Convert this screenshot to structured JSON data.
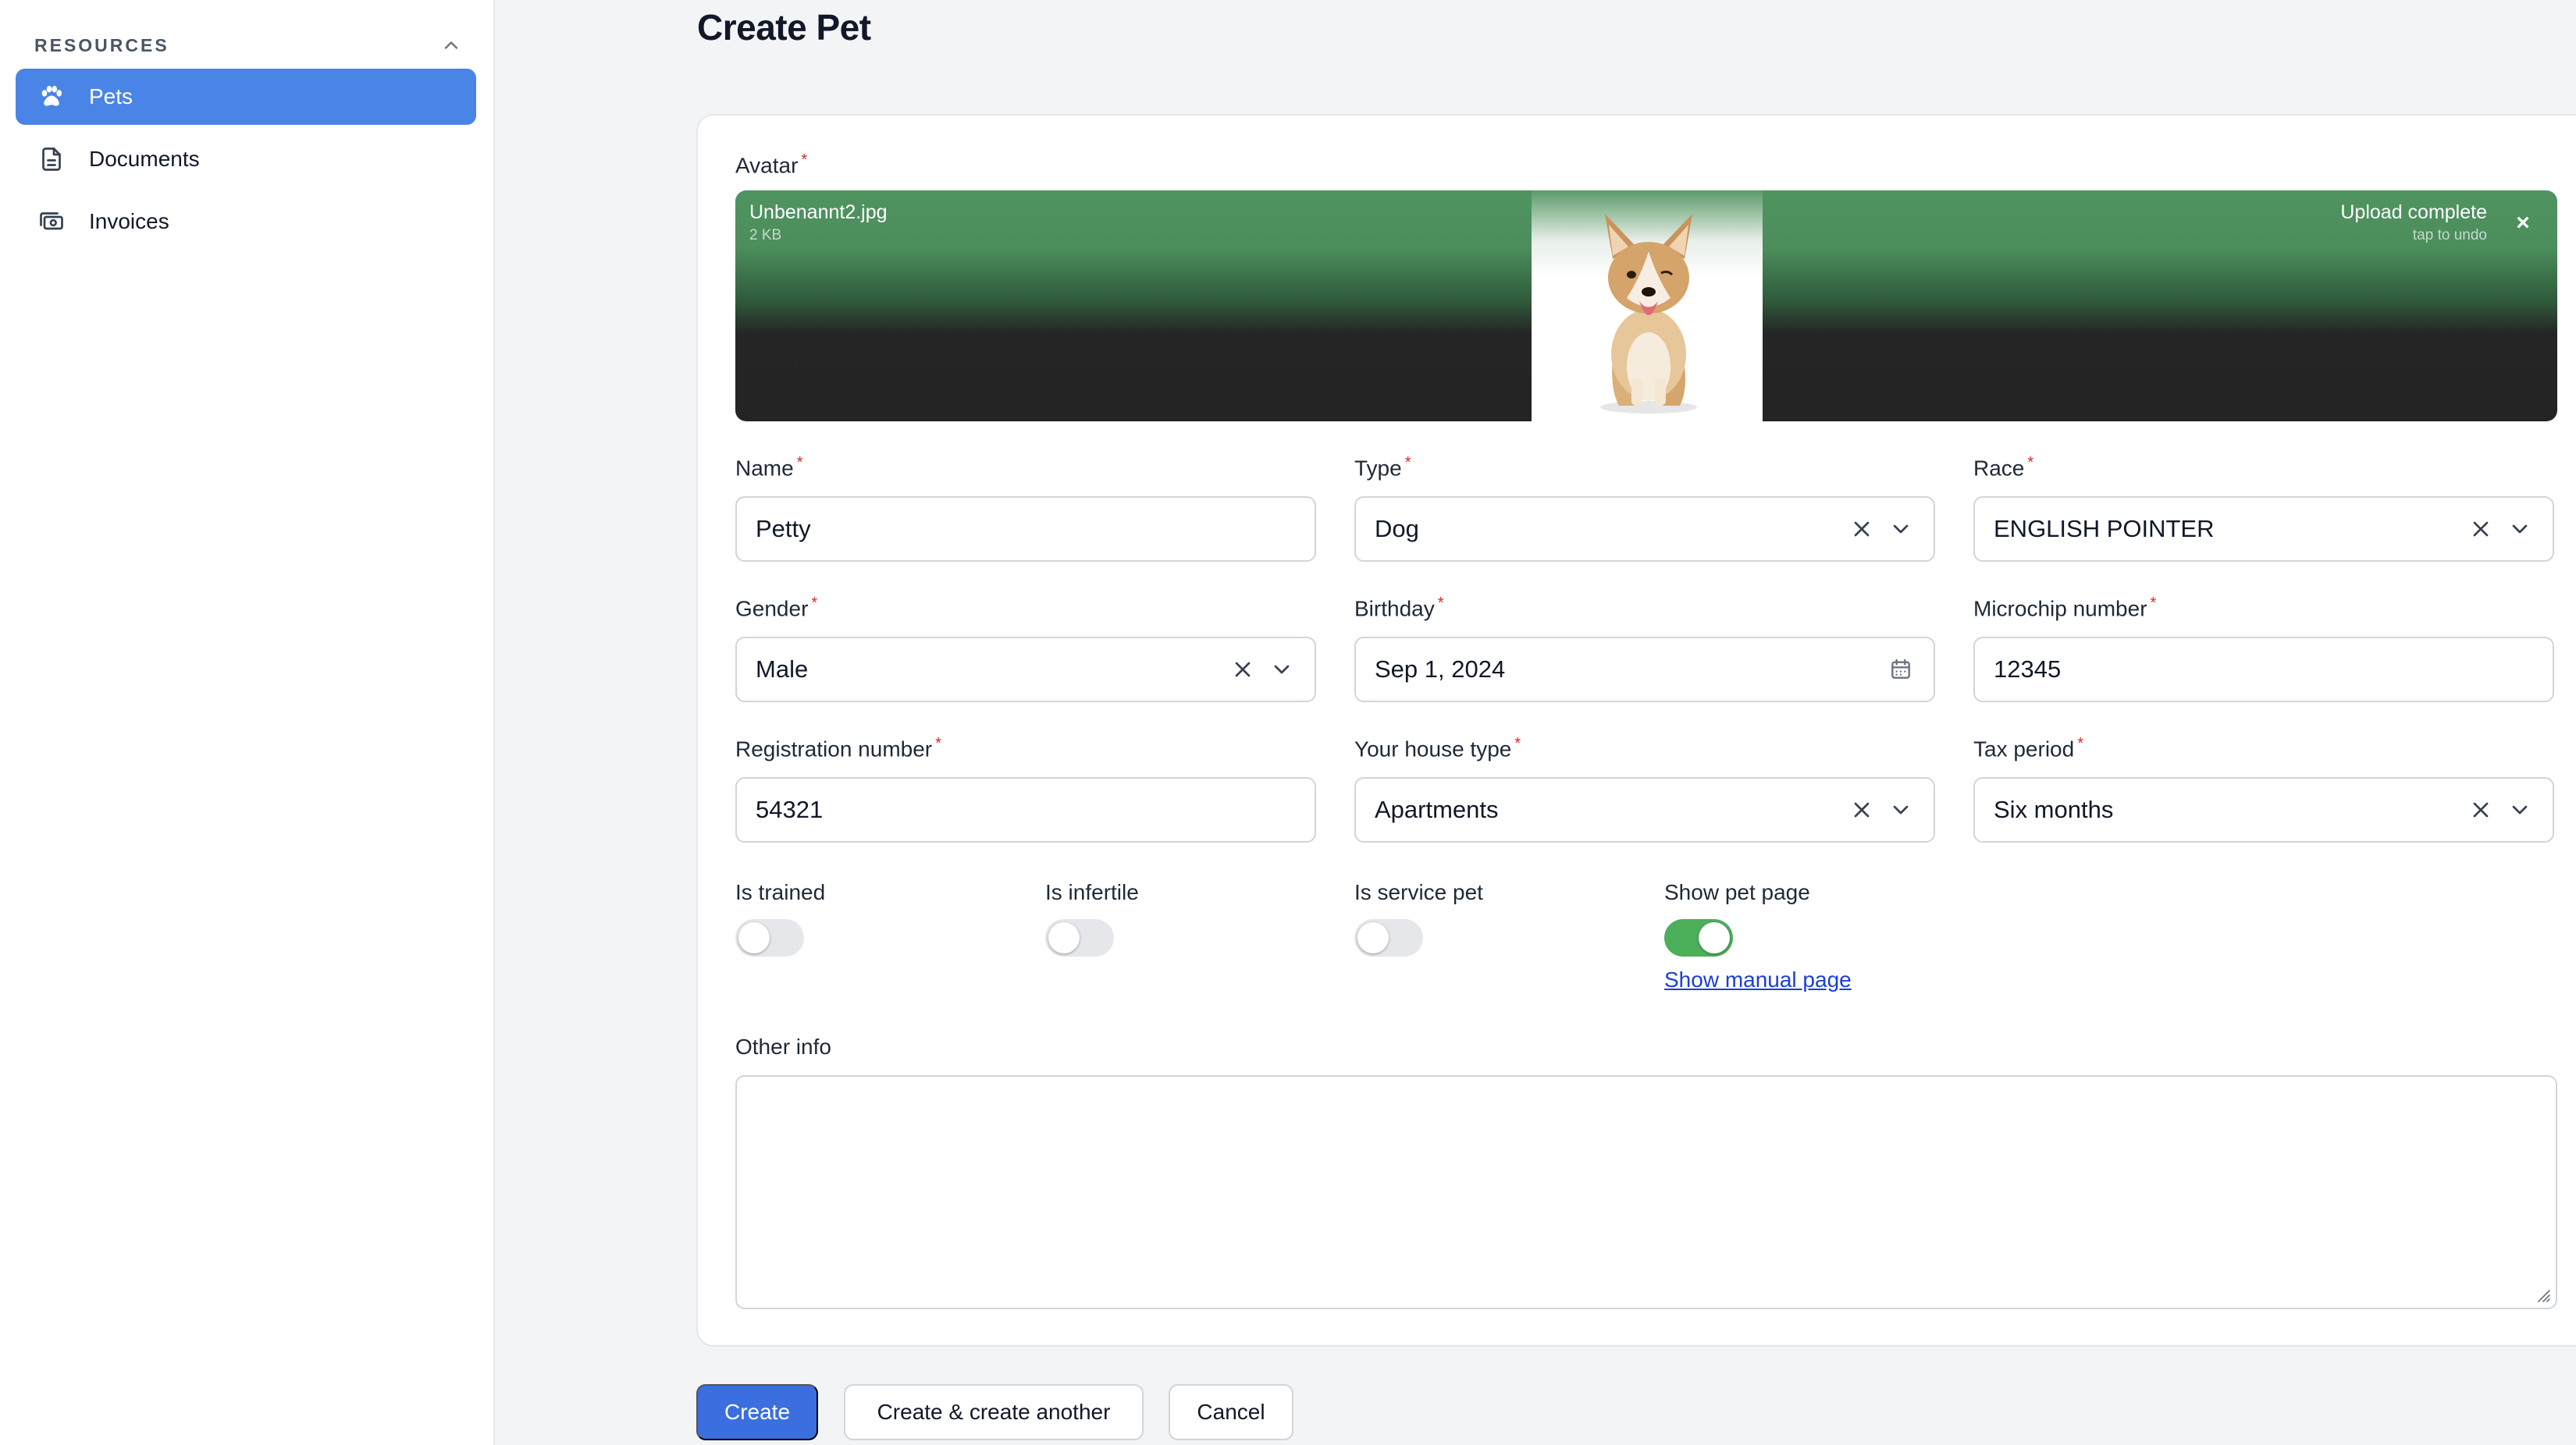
{
  "sidebar": {
    "group_title": "RESOURCES",
    "items": [
      {
        "label": "Pets",
        "icon": "paw-icon",
        "active": true
      },
      {
        "label": "Documents",
        "icon": "document-icon",
        "active": false
      },
      {
        "label": "Invoices",
        "icon": "invoice-icon",
        "active": false
      }
    ]
  },
  "page": {
    "title": "Create Pet"
  },
  "form": {
    "avatar": {
      "label": "Avatar",
      "file_name": "Unbenannt2.jpg",
      "file_size": "2 KB",
      "status": "Upload complete",
      "status_hint": "tap to undo",
      "close_symbol": "×"
    },
    "name": {
      "label": "Name",
      "value": "Petty"
    },
    "type": {
      "label": "Type",
      "value": "Dog"
    },
    "race": {
      "label": "Race",
      "value": "ENGLISH POINTER"
    },
    "gender": {
      "label": "Gender",
      "value": "Male"
    },
    "birthday": {
      "label": "Birthday",
      "value": "Sep 1, 2024"
    },
    "microchip": {
      "label": "Microchip number",
      "value": "12345"
    },
    "registration": {
      "label": "Registration number",
      "value": "54321"
    },
    "house_type": {
      "label": "Your house type",
      "value": "Apartments"
    },
    "tax_period": {
      "label": "Tax period",
      "value": "Six months"
    },
    "toggles": {
      "is_trained": {
        "label": "Is trained",
        "on": false
      },
      "is_infertile": {
        "label": "Is infertile",
        "on": false
      },
      "is_service_pet": {
        "label": "Is service pet",
        "on": false
      },
      "show_pet_page": {
        "label": "Show pet page",
        "on": true
      }
    },
    "show_manual_link": "Show manual page",
    "other_info": {
      "label": "Other info",
      "value": ""
    },
    "required_mark": "*"
  },
  "actions": {
    "create": "Create",
    "create_another": "Create & create another",
    "cancel": "Cancel"
  },
  "colors": {
    "accent": "#4a84e6",
    "primary_button": "#3b6fe0",
    "toggle_on": "#4caf5a",
    "required": "#dc2626",
    "link": "#1a3fd6"
  }
}
